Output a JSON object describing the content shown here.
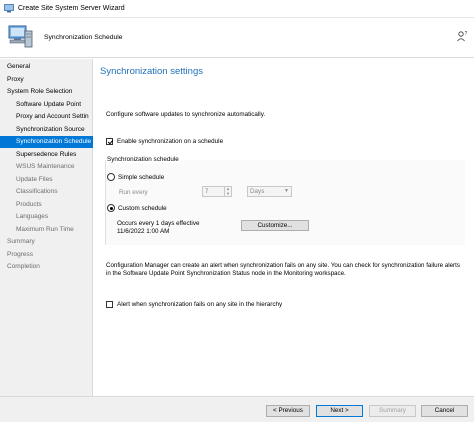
{
  "window": {
    "title": "Create Site System Server Wizard"
  },
  "header": {
    "title": "Synchronization Schedule"
  },
  "nav": {
    "items": [
      {
        "label": "General",
        "level": 0,
        "state": "normal"
      },
      {
        "label": "Proxy",
        "level": 0,
        "state": "normal"
      },
      {
        "label": "System Role Selection",
        "level": 0,
        "state": "normal"
      },
      {
        "label": "Software Update Point",
        "level": 1,
        "state": "normal"
      },
      {
        "label": "Proxy and Account Settin",
        "level": 1,
        "state": "normal"
      },
      {
        "label": "Synchronization Source",
        "level": 1,
        "state": "normal"
      },
      {
        "label": "Synchronization Schedule",
        "level": 1,
        "state": "selected"
      },
      {
        "label": "Supersedence Rules",
        "level": 1,
        "state": "normal"
      },
      {
        "label": "WSUS Maintenance",
        "level": 1,
        "state": "dim"
      },
      {
        "label": "Update Files",
        "level": 1,
        "state": "dim"
      },
      {
        "label": "Classifications",
        "level": 1,
        "state": "dim"
      },
      {
        "label": "Products",
        "level": 1,
        "state": "dim"
      },
      {
        "label": "Languages",
        "level": 1,
        "state": "dim"
      },
      {
        "label": "Maximum Run Time",
        "level": 1,
        "state": "dim"
      },
      {
        "label": "Summary",
        "level": 0,
        "state": "dim"
      },
      {
        "label": "Progress",
        "level": 0,
        "state": "dim"
      },
      {
        "label": "Completion",
        "level": 0,
        "state": "dim"
      }
    ]
  },
  "main": {
    "section_title": "Synchronization settings",
    "description": "Configure software updates to synchronize automatically.",
    "enable_schedule": {
      "label": "Enable synchronization on a schedule",
      "checked": true
    },
    "schedule_group": {
      "title": "Synchronization schedule",
      "simple": {
        "label": "Simple schedule",
        "checked": false
      },
      "run_every_label": "Run every",
      "run_every_value": "7",
      "unit_value": "Days",
      "custom": {
        "label": "Custom schedule",
        "checked": true
      },
      "occurs_text": "Occurs every 1 days effective 11/6/2022 1:00 AM",
      "customize_label": "Customize..."
    },
    "alert_text": "Configuration Manager can create an alert when synchronization fails on any site. You can check for synchronization failure alerts in the Software Update Point Synchronization Status node in the Monitoring workspace.",
    "alert_checkbox": {
      "label": "Alert when synchronization fails on any site in the hierarchy",
      "checked": false
    }
  },
  "footer": {
    "previous_label": "< Previous",
    "next_label": "Next >",
    "summary_label": "Summary",
    "cancel_label": "Cancel"
  },
  "colors": {
    "accent": "#0078d7",
    "section_title": "#1e6fb8"
  }
}
